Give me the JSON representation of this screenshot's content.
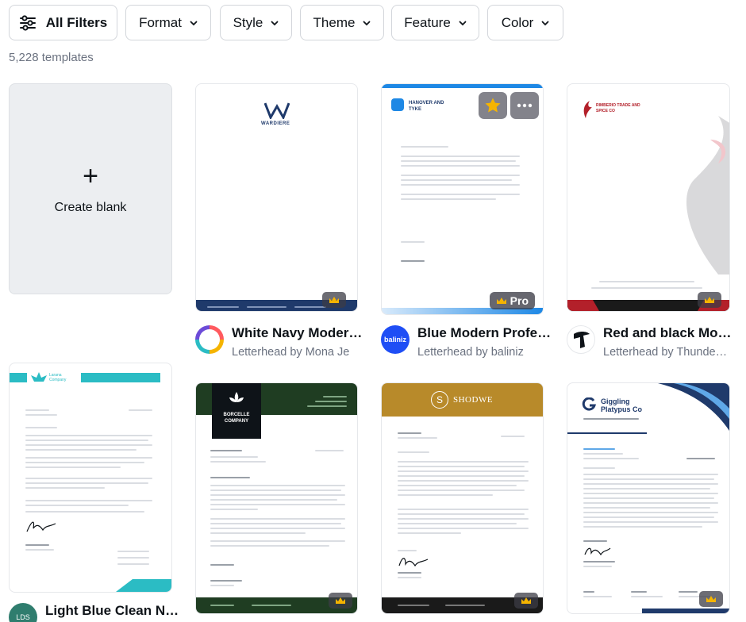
{
  "filters": {
    "all_filters": "All Filters",
    "format": "Format",
    "style": "Style",
    "theme": "Theme",
    "feature": "Feature",
    "color": "Color"
  },
  "results_count": "5,228 templates",
  "create_blank": {
    "label": "Create blank",
    "icon": "plus-icon"
  },
  "templates": [
    {
      "title": "White Navy Moder…",
      "subtitle": "Letterhead by Mona Je",
      "badge": "crown",
      "brand": "WARDIERE"
    },
    {
      "title": "Blue Modern Profe…",
      "subtitle": "Letterhead by baliniz",
      "badge": "Pro",
      "brand": "HANOVER AND TYKE",
      "avatar_text": "baliniz"
    },
    {
      "title": "Red and black Mo…",
      "subtitle": "Letterhead by Thunde…",
      "badge": "crown",
      "brand": "RIMBERIO TRADE AND SPICE CO"
    },
    {
      "title": "Light Blue Clean N…",
      "subtitle": "",
      "badge": "none",
      "brand": "Larana Company",
      "avatar_text": "LDS"
    },
    {
      "title": "",
      "subtitle": "",
      "badge": "crown",
      "brand": "BORCELLE COMPANY"
    },
    {
      "title": "",
      "subtitle": "",
      "badge": "crown",
      "brand": "SHODWE"
    },
    {
      "title": "",
      "subtitle": "",
      "badge": "crown",
      "brand": "Giggling Platypus Co"
    }
  ],
  "colors": {
    "navy": "#1f3a6b",
    "teal": "#2bbcc4",
    "blue_accent": "#1e88e5",
    "red": "#b3202a",
    "green_dark": "#1f3d22",
    "gold": "#b88a2a",
    "baliniz_blue": "#1f4ef5"
  }
}
